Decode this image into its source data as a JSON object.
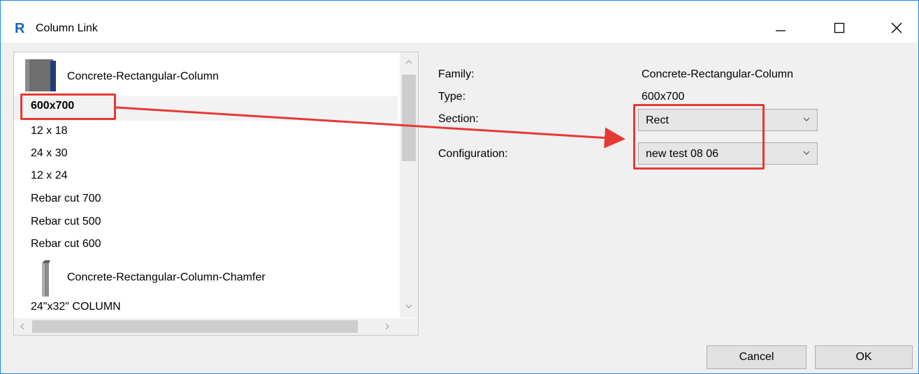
{
  "window": {
    "title": "Column Link",
    "app_icon_letter": "R"
  },
  "list": {
    "families": [
      {
        "name": "Concrete-Rectangular-Column",
        "types": [
          "600x700",
          "12 x 18",
          "24 x 30",
          "12 x 24",
          "Rebar cut 700",
          "Rebar cut 500",
          "Rebar cut 600"
        ]
      },
      {
        "name": "Concrete-Rectangular-Column-Chamfer",
        "types": [
          "24\"x32\" COLUMN"
        ]
      }
    ],
    "selected": "600x700"
  },
  "properties": {
    "family_label": "Family:",
    "family_value": "Concrete-Rectangular-Column",
    "type_label": "Type:",
    "type_value": "600x700",
    "section_label": "Section:",
    "section_value": "Rect",
    "configuration_label": "Configuration:",
    "configuration_value": "new test 08 06"
  },
  "buttons": {
    "cancel": "Cancel",
    "ok": "OK"
  },
  "colors": {
    "highlight": "#e53935",
    "accent": "#1565c0"
  },
  "icons": [
    "revit-app-icon",
    "minimize-icon",
    "maximize-icon",
    "close-icon",
    "column-family-icon",
    "chamfer-column-family-icon",
    "chevron-down-icon",
    "arrow-annotation"
  ]
}
